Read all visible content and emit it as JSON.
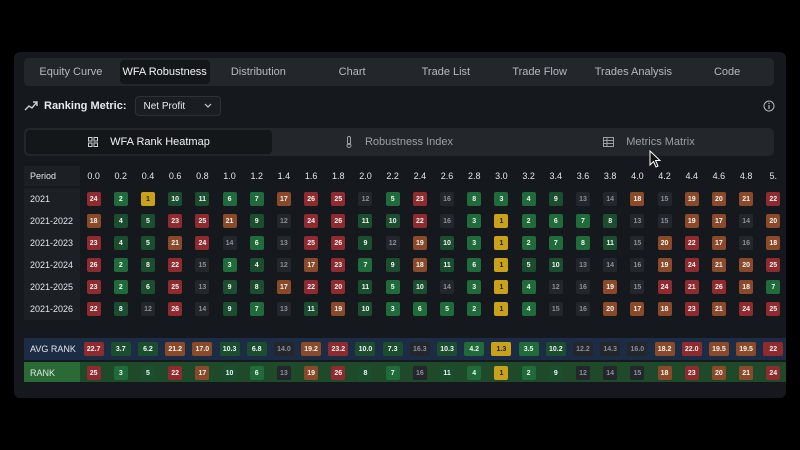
{
  "tabs": [
    "Equity Curve",
    "WFA Robustness",
    "Distribution",
    "Chart",
    "Trade List",
    "Trade Flow",
    "Trades Analysis",
    "Code"
  ],
  "active_tab": 1,
  "ranking": {
    "label": "Ranking Metric:",
    "value": "Net Profit"
  },
  "subtabs": [
    {
      "label": "WFA Rank Heatmap",
      "icon": "grid-icon"
    },
    {
      "label": "Robustness Index",
      "icon": "thermometer-icon"
    },
    {
      "label": "Metrics Matrix",
      "icon": "table-icon"
    }
  ],
  "active_subtab": 0,
  "heatmap": {
    "period_header": "Period",
    "columns": [
      "0.0",
      "0.2",
      "0.4",
      "0.6",
      "0.8",
      "1.0",
      "1.2",
      "1.4",
      "1.6",
      "1.8",
      "2.0",
      "2.2",
      "2.4",
      "2.6",
      "2.8",
      "3.0",
      "3.2",
      "3.4",
      "3.6",
      "3.8",
      "4.0",
      "4.2",
      "4.4",
      "4.6",
      "4.8",
      "5."
    ],
    "rows": [
      {
        "label": "2021",
        "values": [
          "24",
          "2",
          "1",
          "10",
          "11",
          "6",
          "7",
          "17",
          "26",
          "25",
          "12",
          "5",
          "23",
          "16",
          "8",
          "3",
          "4",
          "9",
          "13",
          "14",
          "18",
          "15",
          "19",
          "20",
          "21",
          "22"
        ],
        "colors": [
          "red",
          "green",
          "gold",
          "dkgreen",
          "dkgreen",
          "green",
          "green",
          "orange",
          "red",
          "red",
          "none",
          "green",
          "red",
          "none",
          "green",
          "green",
          "green",
          "dkgreen",
          "none",
          "none",
          "orange",
          "none",
          "orange",
          "orange",
          "orange",
          "red"
        ]
      },
      {
        "label": "2021-2022",
        "values": [
          "18",
          "4",
          "5",
          "23",
          "25",
          "21",
          "9",
          "12",
          "24",
          "26",
          "11",
          "10",
          "22",
          "16",
          "3",
          "1",
          "2",
          "6",
          "7",
          "8",
          "13",
          "15",
          "19",
          "17",
          "14",
          "20"
        ],
        "colors": [
          "orange",
          "dkgreen",
          "dkgreen",
          "red",
          "red",
          "orange",
          "dkgreen",
          "none",
          "red",
          "red",
          "dkgreen",
          "dkgreen",
          "red",
          "none",
          "green",
          "gold",
          "green",
          "green",
          "green",
          "dkgreen",
          "none",
          "none",
          "orange",
          "orange",
          "none",
          "orange"
        ]
      },
      {
        "label": "2021-2023",
        "values": [
          "23",
          "4",
          "5",
          "21",
          "24",
          "14",
          "6",
          "13",
          "25",
          "26",
          "9",
          "12",
          "19",
          "10",
          "3",
          "1",
          "2",
          "7",
          "8",
          "11",
          "15",
          "20",
          "22",
          "17",
          "16",
          "18"
        ],
        "colors": [
          "red",
          "dkgreen",
          "dkgreen",
          "orange",
          "red",
          "none",
          "green",
          "none",
          "red",
          "red",
          "dkgreen",
          "none",
          "orange",
          "dkgreen",
          "green",
          "gold",
          "green",
          "green",
          "green",
          "dkgreen",
          "none",
          "orange",
          "red",
          "orange",
          "none",
          "orange"
        ]
      },
      {
        "label": "2021-2024",
        "values": [
          "26",
          "2",
          "8",
          "22",
          "15",
          "3",
          "4",
          "12",
          "17",
          "23",
          "7",
          "9",
          "18",
          "11",
          "6",
          "1",
          "5",
          "10",
          "13",
          "14",
          "16",
          "19",
          "24",
          "21",
          "20",
          "25"
        ],
        "colors": [
          "red",
          "green",
          "dkgreen",
          "red",
          "none",
          "green",
          "dkgreen",
          "none",
          "orange",
          "red",
          "green",
          "dkgreen",
          "orange",
          "dkgreen",
          "green",
          "gold",
          "dkgreen",
          "dkgreen",
          "none",
          "none",
          "none",
          "orange",
          "red",
          "orange",
          "orange",
          "red"
        ]
      },
      {
        "label": "2021-2025",
        "values": [
          "23",
          "2",
          "6",
          "25",
          "13",
          "9",
          "8",
          "17",
          "22",
          "20",
          "11",
          "5",
          "10",
          "14",
          "3",
          "1",
          "4",
          "12",
          "16",
          "19",
          "15",
          "24",
          "21",
          "26",
          "18",
          "7"
        ],
        "colors": [
          "red",
          "green",
          "dkgreen",
          "red",
          "none",
          "dkgreen",
          "dkgreen",
          "orange",
          "red",
          "red",
          "dkgreen",
          "green",
          "dkgreen",
          "none",
          "green",
          "gold",
          "green",
          "none",
          "none",
          "orange",
          "none",
          "red",
          "red",
          "red",
          "orange",
          "green"
        ]
      },
      {
        "label": "2021-2026",
        "values": [
          "22",
          "8",
          "12",
          "26",
          "14",
          "9",
          "7",
          "13",
          "11",
          "19",
          "10",
          "3",
          "6",
          "5",
          "2",
          "1",
          "4",
          "15",
          "16",
          "20",
          "17",
          "18",
          "23",
          "21",
          "24",
          "25"
        ],
        "colors": [
          "red",
          "dkgreen",
          "none",
          "red",
          "none",
          "dkgreen",
          "green",
          "none",
          "dkgreen",
          "orange",
          "dkgreen",
          "green",
          "green",
          "green",
          "green",
          "gold",
          "green",
          "none",
          "none",
          "orange",
          "orange",
          "orange",
          "red",
          "orange",
          "red",
          "red"
        ]
      }
    ],
    "avg_rank": {
      "label": "AVG RANK",
      "values": [
        "22.7",
        "3.7",
        "6.2",
        "21.2",
        "17.0",
        "10.3",
        "6.8",
        "14.0",
        "19.2",
        "23.2",
        "10.0",
        "7.3",
        "16.3",
        "10.3",
        "4.2",
        "1.3",
        "3.5",
        "10.2",
        "12.2",
        "14.3",
        "16.0",
        "18.2",
        "22.0",
        "19.5",
        "19.5",
        "22"
      ],
      "colors": [
        "red",
        "dkgreen",
        "dkgreen",
        "orange",
        "orange",
        "dkgreen",
        "dkgreen",
        "none",
        "orange",
        "red",
        "dkgreen",
        "dkgreen",
        "none",
        "dkgreen",
        "green",
        "gold",
        "green",
        "dkgreen",
        "none",
        "none",
        "none",
        "orange",
        "red",
        "orange",
        "orange",
        "red"
      ]
    },
    "rank": {
      "label": "RANK",
      "values": [
        "25",
        "3",
        "5",
        "22",
        "17",
        "10",
        "6",
        "13",
        "19",
        "26",
        "8",
        "7",
        "16",
        "11",
        "4",
        "1",
        "2",
        "9",
        "12",
        "14",
        "15",
        "18",
        "23",
        "20",
        "21",
        "24"
      ],
      "colors": [
        "red",
        "green",
        "dkgreen",
        "red",
        "orange",
        "dkgreen",
        "green",
        "none",
        "orange",
        "red",
        "dkgreen",
        "green",
        "none",
        "dkgreen",
        "green",
        "gold",
        "green",
        "dkgreen",
        "none",
        "none",
        "none",
        "orange",
        "red",
        "orange",
        "orange",
        "red"
      ]
    }
  }
}
